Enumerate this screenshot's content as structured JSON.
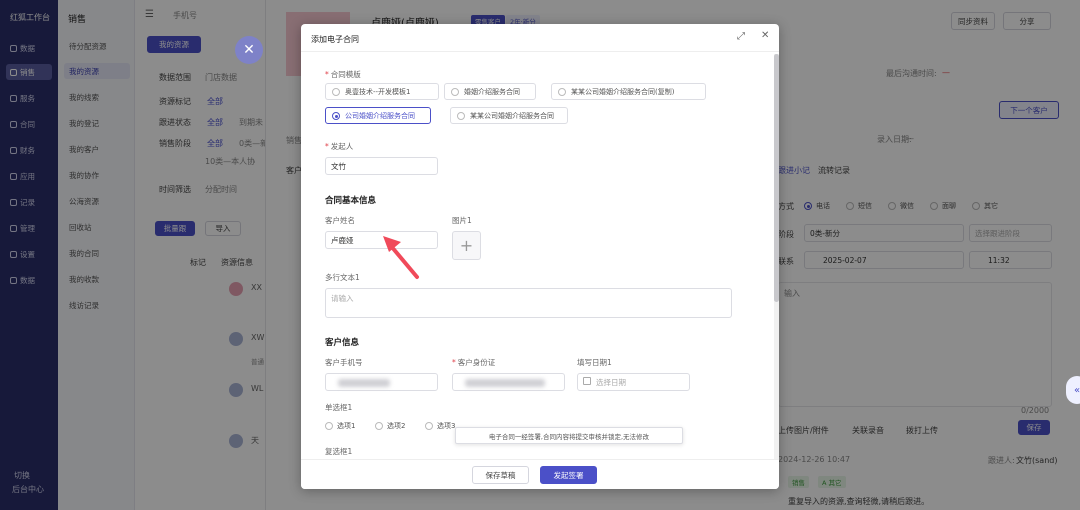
{
  "nav": {
    "logo": "红狐工作台",
    "items": [
      "数据",
      "销售",
      "服务",
      "合同",
      "财务",
      "应用",
      "记录",
      "管理",
      "设置",
      "数据"
    ],
    "bottom": [
      "切换",
      "后台中心"
    ]
  },
  "sub": {
    "title": "销售",
    "items": [
      "待分配资源",
      "我的资源",
      "我的线索",
      "我的登记",
      "我的客户",
      "我的协作",
      "公海资源",
      "回收站",
      "我的合同",
      "我的收款",
      "线访记录"
    ]
  },
  "main": {
    "search_placeholder": "手机号",
    "tab_my": "我的资源",
    "data_scope": "数据范围",
    "data_scope_val": "门店数据",
    "filter_rows": [
      {
        "label": "资源标记",
        "value": "全部"
      },
      {
        "label": "跟进状态",
        "value": "全部",
        "extra": "到期未"
      },
      {
        "label": "销售阶段",
        "value": "全部",
        "extra": "0类—新"
      }
    ],
    "stage_sub": "10类—本人协",
    "time_range": "时间筛选",
    "time_range_val": "分配时间",
    "tool_buttons": [
      "批量跟",
      "导入"
    ],
    "col_mark": "标记",
    "col_info": "资源信息",
    "customer_label": "客户",
    "customer_name": "卢鹿娅(卢鹿娅)",
    "tag1": "零售客户",
    "tag2": "2年·新分",
    "sync_btn": "同步资料",
    "share_btn": "分享",
    "last_contact": "最后沟通时间:",
    "last_contact_val": "—",
    "next_customer": "下一个客户",
    "entry_date_label": "录入日期:",
    "entry_date_val": "—",
    "sales_label": "销售",
    "right_tabs": [
      "跟进小记",
      "流转记录"
    ],
    "method_label": "方式",
    "methods": [
      "电话",
      "短信",
      "微信",
      "面聊",
      "其它"
    ],
    "stage_label": "阶段",
    "stage_val": "0类-新分",
    "next_placeholder": "选择跟进阶段",
    "contact_label": "联系",
    "date_val": "2025-02-07",
    "time_val": "11:32",
    "note_placeholder": "输入",
    "counter": "0/2000",
    "upload_label": "上传图片/附件",
    "record_label": "关联录音",
    "call_label": "拨打上传",
    "save_btn": "保存",
    "log_time": "2024-12-26 10:47",
    "log_user_label": "跟进人:",
    "log_user": "文竹(sand)",
    "log_tags": [
      "销售",
      "A 其它"
    ],
    "log_text": "重复导入的资源,查询轻微,请稍后跟进。",
    "left_rows": [
      "XX",
      "XW",
      "WL",
      "天"
    ],
    "row_badge": "普通"
  },
  "dialog": {
    "title": "添加电子合同",
    "template_label": "合同模版",
    "templates": [
      {
        "label": "奥壹技术--开发模板1",
        "selected": false
      },
      {
        "label": "婚姻介绍服务合同",
        "selected": false
      },
      {
        "label": "某某公司婚姻介绍服务合同(复制)",
        "selected": false
      },
      {
        "label": "公司婚姻介绍服务合同",
        "selected": true
      },
      {
        "label": "某某公司婚姻介绍服务合同",
        "selected": false
      }
    ],
    "initiator_label": "发起人",
    "initiator_value": "文竹",
    "basic_section": "合同基本信息",
    "customer_name_label": "客户姓名",
    "customer_name_value": "卢鹿娅",
    "image_label": "图片1",
    "multiline_label": "多行文本1",
    "multiline_placeholder": "请输入",
    "customer_section": "客户信息",
    "phone_label": "客户手机号",
    "id_label": "客户身份证",
    "date_label": "填写日期1",
    "date_placeholder": "选择日期",
    "radio_group_label": "单选框1",
    "radio_options": [
      "选项1",
      "选项2",
      "选项3"
    ],
    "checkbox_group_label": "复选框1",
    "tooltip": "电子合同一经签署,合同内容将提交审核并锁定,无法修改",
    "save_draft": "保存草稿",
    "submit": "发起签署"
  },
  "colors": {
    "primary": "#4b50c8",
    "nav_bg": "#2b2f6b",
    "arrow": "#f04a5a"
  }
}
